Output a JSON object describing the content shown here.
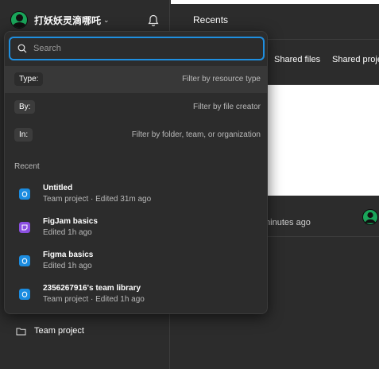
{
  "sidebar": {
    "user_name": "打妖妖灵滴哪吒",
    "user_chevron": "⌄",
    "team_project": "Team project"
  },
  "main": {
    "title": "Recents",
    "tabs": [
      "Shared files",
      "Shared projects"
    ],
    "file_meta": "minutes ago"
  },
  "popover": {
    "search_placeholder": "Search",
    "filters": [
      {
        "chip": "Type:",
        "hint": "Filter by resource type"
      },
      {
        "chip": "By:",
        "hint": "Filter by file creator"
      },
      {
        "chip": "In:",
        "hint": "Filter by folder, team, or organization"
      }
    ],
    "recent_heading": "Recent",
    "recent_items": [
      {
        "title": "Untitled",
        "sub": "Team project · Edited 31m ago",
        "icon": "figma-file-icon"
      },
      {
        "title": "FigJam basics",
        "sub": "Edited 1h ago",
        "icon": "figjam-file-icon"
      },
      {
        "title": "Figma basics",
        "sub": "Edited 1h ago",
        "icon": "figma-file-icon"
      },
      {
        "title": "2356267916's team library",
        "sub": "Team project · Edited 1h ago",
        "icon": "figma-file-icon"
      }
    ]
  },
  "colors": {
    "accent": "#1f8fe0",
    "figma_icon": "#1b8ce0",
    "figjam_icon": "#8b4fe0",
    "avatar": "#1aa55a"
  }
}
